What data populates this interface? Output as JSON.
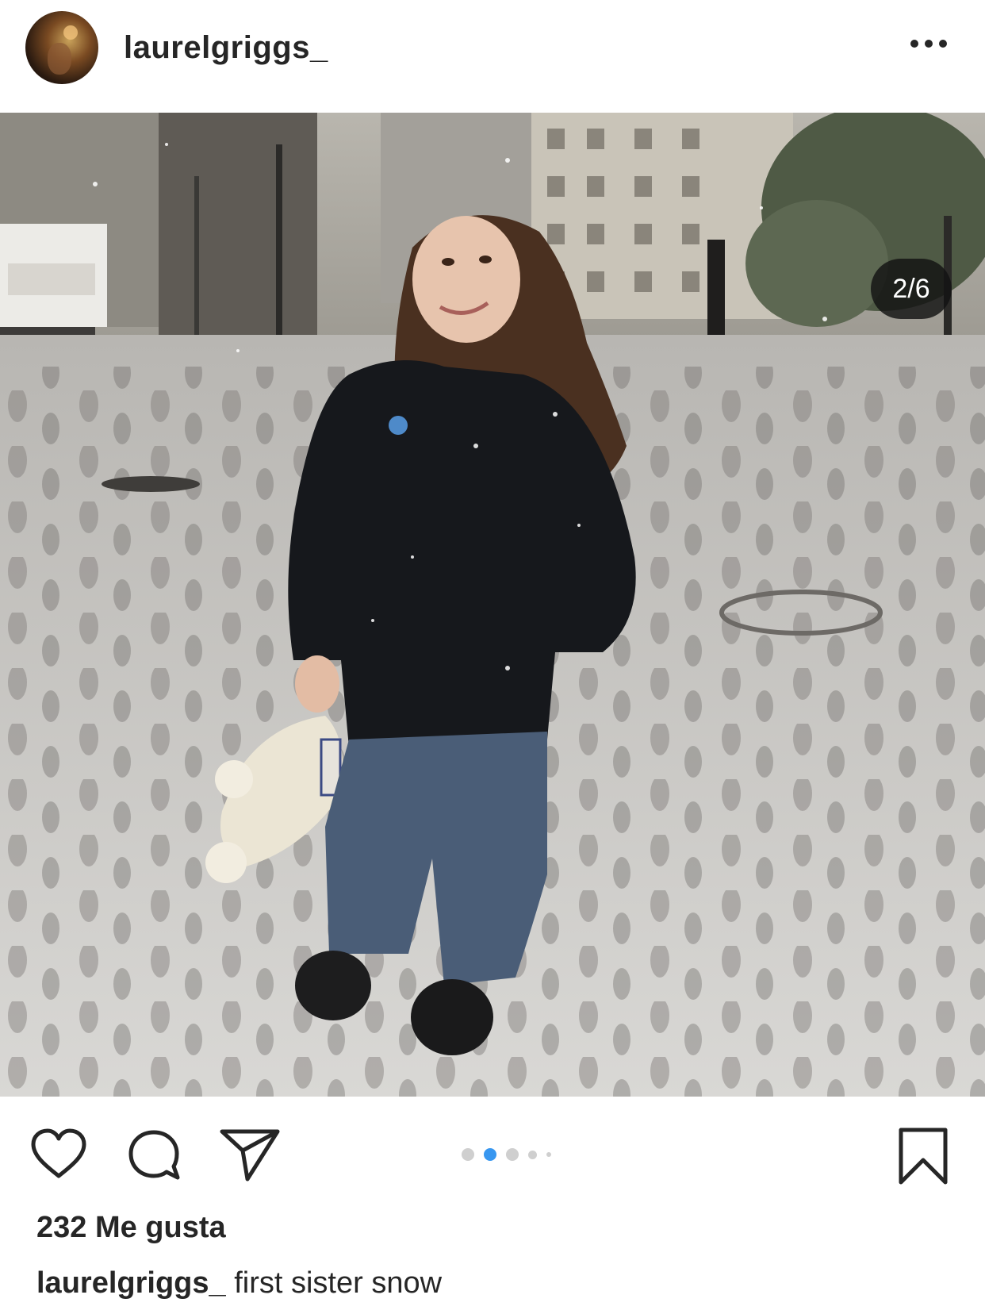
{
  "post": {
    "username": "laurelgriggs_",
    "more_icon": "more-horizontal-icon",
    "image_counter": "2/6",
    "carousel": {
      "count": 5,
      "active_index": 1
    },
    "likes_text": "232 Me gusta",
    "caption": {
      "username": "laurelgriggs_",
      "text": "first sister snow"
    }
  },
  "actions": {
    "like_icon": "heart-icon",
    "comment_icon": "comment-bubble-icon",
    "share_icon": "paper-plane-icon",
    "save_icon": "bookmark-icon"
  },
  "colors": {
    "accent": "#3897f0",
    "text": "#262626",
    "counter_bg": "#121212"
  }
}
